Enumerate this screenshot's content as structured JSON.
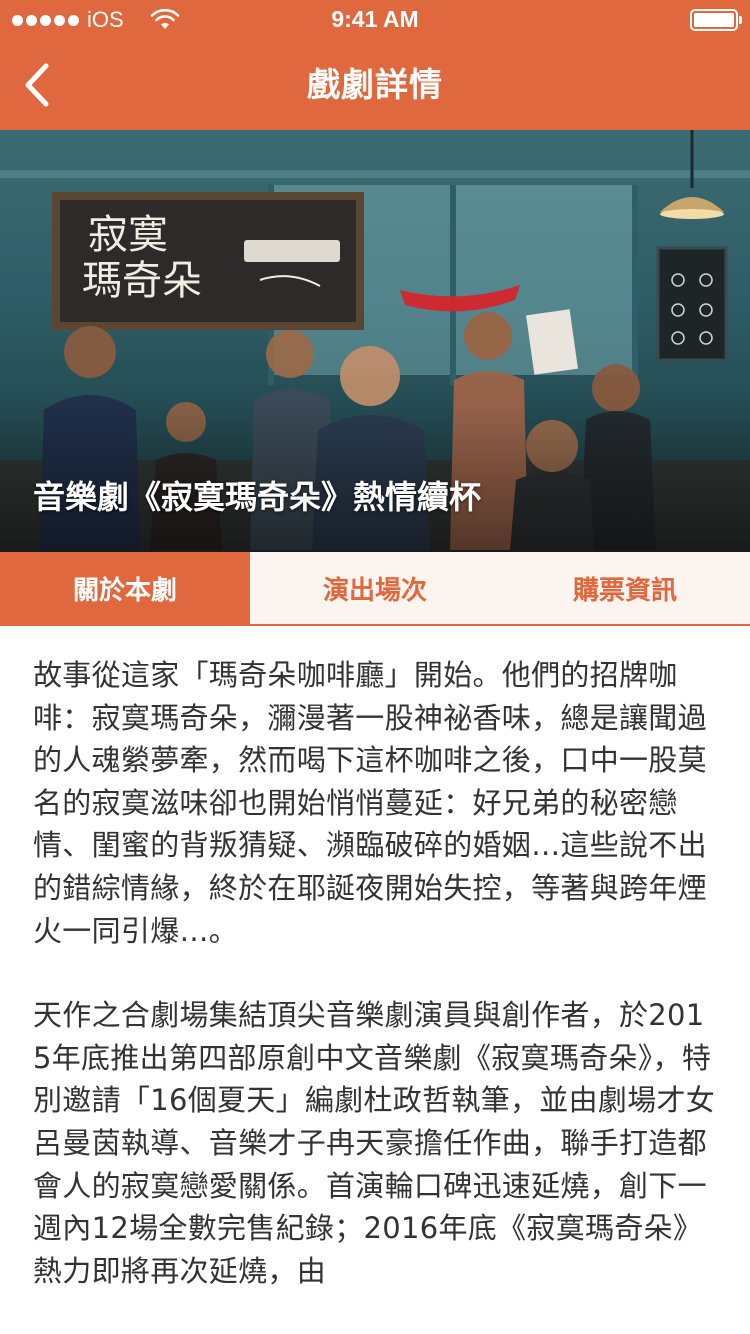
{
  "status_bar": {
    "carrier": "iOS",
    "time": "9:41 AM"
  },
  "nav": {
    "title": "戲劇詳情",
    "back_icon": "chevron-left-icon"
  },
  "hero": {
    "caption": "音樂劇《寂寞瑪奇朵》熱情續杯",
    "poster_title_line1": "寂寞",
    "poster_title_line2": "瑪奇朵"
  },
  "tabs": [
    {
      "label": "關於本劇",
      "active": true
    },
    {
      "label": "演出場次",
      "active": false
    },
    {
      "label": "購票資訊",
      "active": false
    }
  ],
  "content": {
    "paragraphs": [
      "故事從這家「瑪奇朵咖啡廳」開始。他們的招牌咖啡：寂寞瑪奇朵，瀰漫著一股神祕香味，總是讓聞過的人魂縈夢牽，然而喝下這杯咖啡之後，口中一股莫名的寂寞滋味卻也開始悄悄蔓延：好兄弟的秘密戀情、閨蜜的背叛猜疑、瀕臨破碎的婚姻…這些說不出的錯綜情緣，終於在耶誕夜開始失控，等著與跨年煙火一同引爆…。",
      "天作之合劇場集結頂尖音樂劇演員與創作者，於2015年底推出第四部原創中文音樂劇《寂寞瑪奇朵》，特別邀請「16個夏天」編劇杜政哲執筆，並由劇場才女呂曼茵執導、音樂才子冉天豪擔任作曲，聯手打造都會人的寂寞戀愛關係。首演輪口碑迅速延燒，創下一週內12場全數完售紀錄；2016年底《寂寞瑪奇朵》熱力即將再次延燒，由"
    ]
  },
  "colors": {
    "accent": "#e0683e",
    "text": "#333333",
    "tab_bg": "#fcf4ef"
  }
}
